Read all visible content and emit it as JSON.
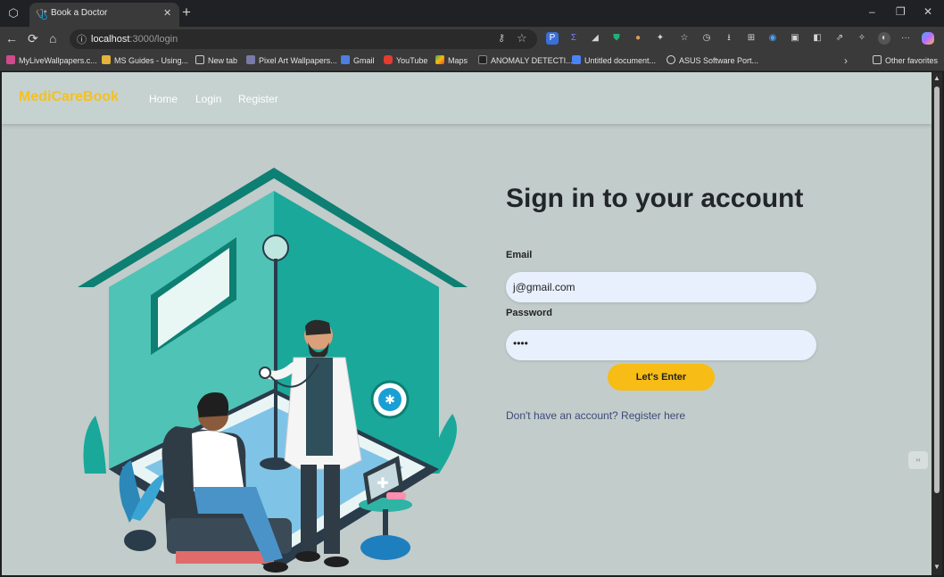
{
  "browser": {
    "tab_title": "Book a Doctor",
    "url_host": "localhost",
    "url_path": ":3000/login",
    "bookmarks": [
      "MyLiveWallpapers.c...",
      "MS Guides - Using...",
      "New tab",
      "Pixel Art Wallpapers...",
      "Gmail",
      "YouTube",
      "Maps",
      "ANOMALY DETECTI...",
      "Untitled document...",
      "ASUS Software Port..."
    ],
    "other_favorites": "Other favorites",
    "icons": {
      "back": "←",
      "refresh": "⟳",
      "home": "⌂",
      "minimize": "–",
      "restore": "❐",
      "close": "✕",
      "new_tab": "+",
      "more": "···",
      "info": "ⓘ",
      "star": "☆",
      "key": "⚷"
    }
  },
  "site": {
    "brand": "MediCareBook",
    "nav": [
      "Home",
      "Login",
      "Register"
    ]
  },
  "login": {
    "heading": "Sign in to your account",
    "email_label": "Email",
    "email_value": "j@gmail.com",
    "password_label": "Password",
    "password_value": "••••",
    "submit_label": "Let's Enter",
    "register_link": "Don't have an account? Register here"
  },
  "colors": {
    "brand": "#f6c01f",
    "button": "#f7bc16",
    "page_bg": "#c2ccca",
    "house_teal": "#1aa89a",
    "house_dark": "#0d7f73"
  }
}
